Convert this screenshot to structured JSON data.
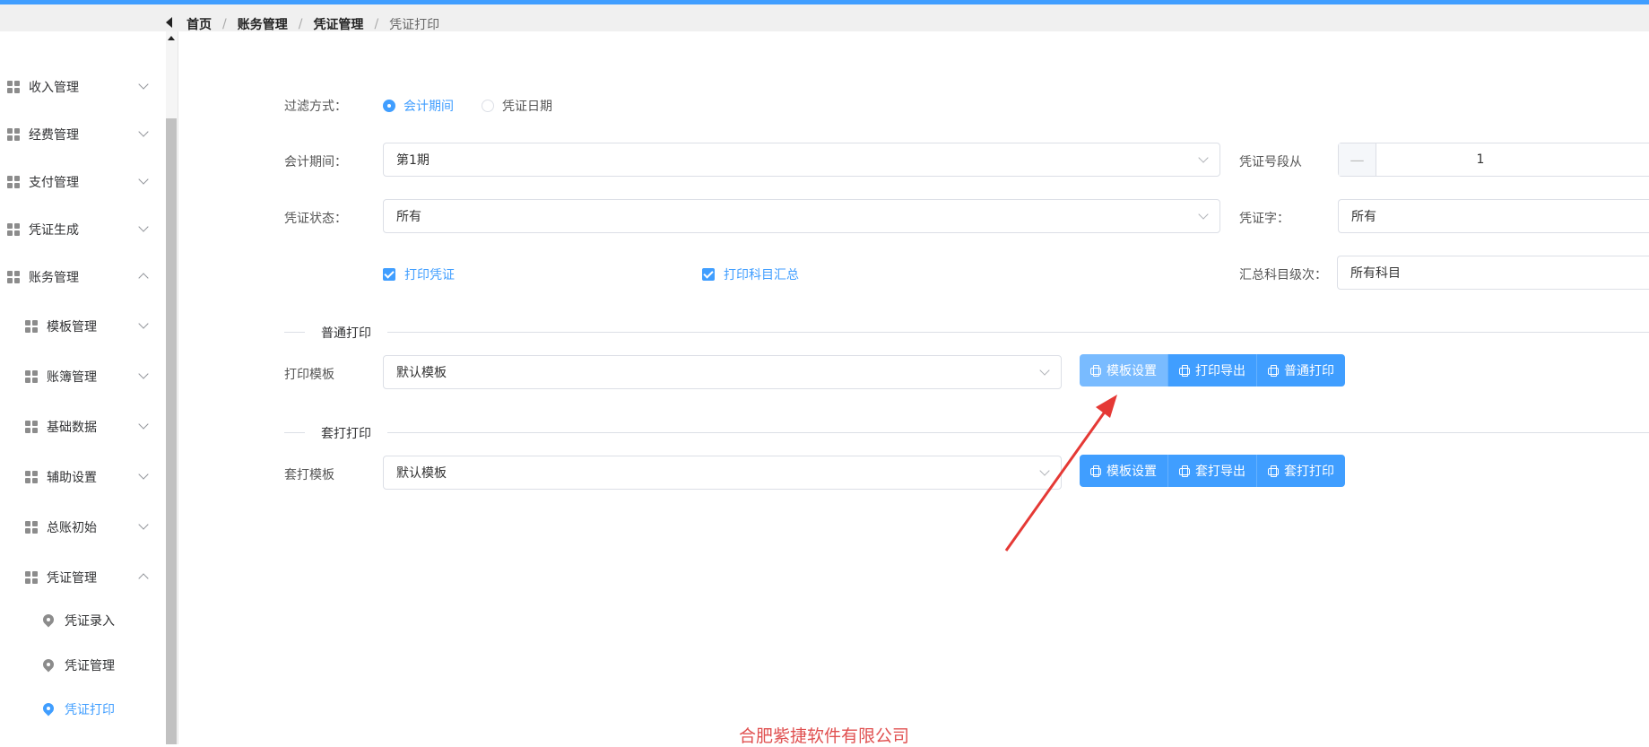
{
  "breadcrumb": [
    "首页",
    "账务管理",
    "凭证管理",
    "凭证打印"
  ],
  "sidebar": {
    "items": [
      {
        "label": "收入管理",
        "level": 1
      },
      {
        "label": "经费管理",
        "level": 1
      },
      {
        "label": "支付管理",
        "level": 1
      },
      {
        "label": "凭证生成",
        "level": 1
      },
      {
        "label": "账务管理",
        "level": 1,
        "expanded": true
      },
      {
        "label": "模板管理",
        "level": 2
      },
      {
        "label": "账簿管理",
        "level": 2
      },
      {
        "label": "基础数据",
        "level": 2
      },
      {
        "label": "辅助设置",
        "level": 2
      },
      {
        "label": "总账初始",
        "level": 2
      },
      {
        "label": "凭证管理",
        "level": 2,
        "expanded": true
      },
      {
        "label": "凭证录入",
        "level": 3
      },
      {
        "label": "凭证管理",
        "level": 3
      },
      {
        "label": "凭证打印",
        "level": 3,
        "active": true
      }
    ]
  },
  "form": {
    "filter_label": "过滤方式：",
    "filter_opt1": "会计期间",
    "filter_opt2": "凭证日期",
    "period_label": "会计期间：",
    "period_value": "第1期",
    "voucher_no_label": "凭证号段从",
    "voucher_no_minus": "—",
    "voucher_no_value": "1",
    "status_label": "凭证状态：",
    "status_value": "所有",
    "word_label": "凭证字：",
    "word_value": "所有",
    "print_voucher": "打印凭证",
    "print_summary": "打印科目汇总",
    "level_label": "汇总科目级次：",
    "level_value": "所有科目"
  },
  "normal_print": {
    "title": "普通打印",
    "template_label": "打印模板",
    "template_value": "默认模板",
    "btn_setting": "模板设置",
    "btn_export": "打印导出",
    "btn_print": "普通打印"
  },
  "overlay_print": {
    "title": "套打打印",
    "template_label": "套打模板",
    "template_value": "默认模板",
    "btn_setting": "模板设置",
    "btn_export": "套打导出",
    "btn_print": "套打打印"
  },
  "footer": "合肥紫捷软件有限公司",
  "colors": {
    "accent": "#409eff",
    "footer": "#e05050",
    "arrow": "#e53935"
  }
}
